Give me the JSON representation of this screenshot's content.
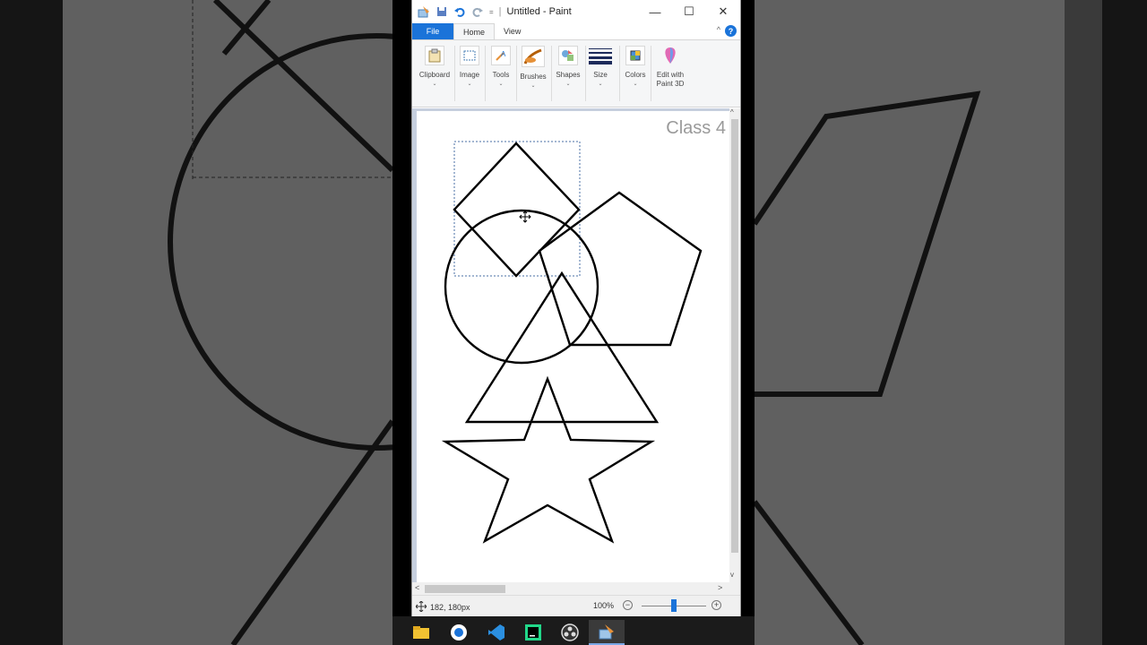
{
  "window": {
    "title": "Untitled - Paint",
    "minimize_glyph": "—",
    "maximize_glyph": "☐",
    "close_glyph": "✕"
  },
  "tabs": {
    "file": "File",
    "home": "Home",
    "view": "View",
    "help_glyph": "?",
    "collapse_glyph": "^"
  },
  "ribbon": {
    "groups": [
      {
        "label": "Clipboard",
        "icon": "clipboard-icon"
      },
      {
        "label": "Image",
        "icon": "image-icon"
      },
      {
        "label": "Tools",
        "icon": "tools-icon"
      },
      {
        "label": "Brushes",
        "icon": "brushes-icon"
      },
      {
        "label": "Shapes",
        "icon": "shapes-icon"
      },
      {
        "label": "Size",
        "icon": "size-icon"
      },
      {
        "label": "Colors",
        "icon": "colors-icon"
      },
      {
        "label": "Edit with\nPaint 3D",
        "icon": "paint3d-icon"
      }
    ],
    "chevron": "⌄"
  },
  "canvas": {
    "watermark": "Class 4",
    "shapes": [
      "diamond",
      "circle",
      "pentagon",
      "triangle",
      "star"
    ],
    "stroke_color": "#000000"
  },
  "status": {
    "position": "182, 180px",
    "zoom": "100%",
    "zoom_minus": "−",
    "zoom_plus": "+",
    "zoom_level": 0.5
  },
  "scroll": {
    "left": "<",
    "right": ">",
    "up": "^",
    "down": "v"
  },
  "taskbar": {
    "items": [
      "file-explorer-icon",
      "chrome-icon",
      "vscode-icon",
      "pycharm-icon",
      "obs-icon",
      "paint-icon"
    ],
    "active": "paint-icon"
  },
  "colors": {
    "accent": "#1a73d9",
    "canvas_bg": "#c6cfde"
  }
}
